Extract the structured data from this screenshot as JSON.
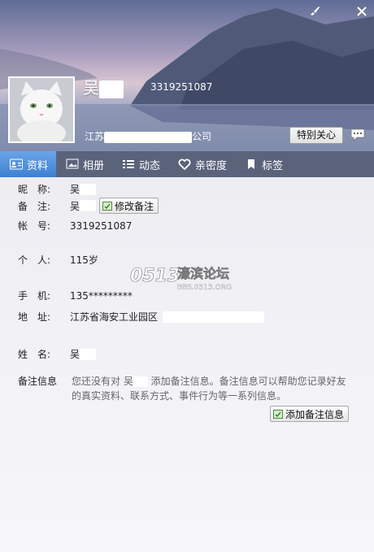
{
  "header": {
    "nickname": "吴",
    "qq_number": "3319251087",
    "company_prefix": "江苏",
    "company_suffix": "公司",
    "special_care_label": "特别关心"
  },
  "icons": {
    "skin": "paintbrush-icon",
    "close": "close-icon",
    "chat": "chat-bubble-icon"
  },
  "tabs": [
    {
      "label": "资料",
      "active": true
    },
    {
      "label": "相册",
      "active": false
    },
    {
      "label": "动态",
      "active": false
    },
    {
      "label": "亲密度",
      "active": false
    },
    {
      "label": "标签",
      "active": false
    }
  ],
  "profile": {
    "nickname_label": "昵　称:",
    "nickname_value": "吴",
    "remark_label": "备　注:",
    "remark_value": "吴",
    "edit_remark_label": "修改备注",
    "account_label": "帐　号:",
    "account_value": "3319251087",
    "personal_label": "个　人:",
    "personal_value": "115岁",
    "phone_label": "手　机:",
    "phone_value": "135*********",
    "address_label": "地　址:",
    "address_value": "江苏省海安工业园区",
    "name_label": "姓　名:",
    "name_value": "吴",
    "note_label": "备注信息",
    "note_text_1": "您还没有对 吴",
    "note_text_2": " 添加备注信息。备注信息可以帮助您记录好友的真实资料、联系方式、事件行为等一系列信息。",
    "add_note_label": "添加备注信息"
  },
  "watermark": {
    "brand": "0513",
    "title": "濠滨论坛",
    "url": "BBS.0513.ORG"
  }
}
